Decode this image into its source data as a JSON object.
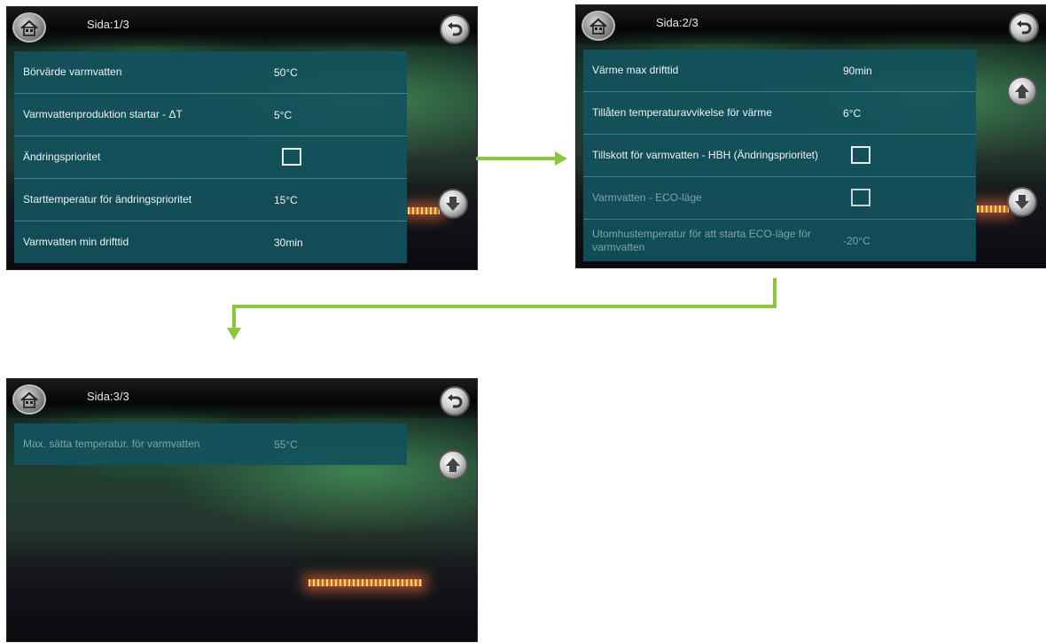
{
  "screens": [
    {
      "page_label": "Sida:1/3",
      "rows": [
        {
          "label": "Börvärde varmvatten",
          "value": "50°C"
        },
        {
          "label": "Varmvattenproduktion startar - ΔT",
          "value": "5°C"
        },
        {
          "label": "Ändringsprioritet",
          "value": ""
        },
        {
          "label": "Starttemperatur för ändringsprioritet",
          "value": "15°C"
        },
        {
          "label": "Varmvatten min drifttid",
          "value": "30min"
        }
      ]
    },
    {
      "page_label": "Sida:2/3",
      "rows": [
        {
          "label": "Värme max drifttid",
          "value": "90min"
        },
        {
          "label": "Tillåten temperaturavvikelse för värme",
          "value": "6°C"
        },
        {
          "label": "Tillskott för varmvatten - HBH (Ändringsprioritet)",
          "value": ""
        },
        {
          "label": "Varmvatten - ECO-läge",
          "value": ""
        },
        {
          "label": "Utomhustemperatur för att starta ECO-läge för varmvatten",
          "value": "-20°C"
        }
      ]
    },
    {
      "page_label": "Sida:3/3",
      "rows": [
        {
          "label": "Max. sätta temperatur. för varmvatten",
          "value": "55°C"
        }
      ]
    }
  ],
  "icons": {
    "home": "home-icon",
    "back": "back-arrow-icon",
    "up": "up-arrow-icon",
    "down": "down-arrow-icon",
    "checkbox": "checkbox"
  },
  "colors": {
    "panel": "#12525c",
    "flow_arrow": "#8cc63f"
  }
}
